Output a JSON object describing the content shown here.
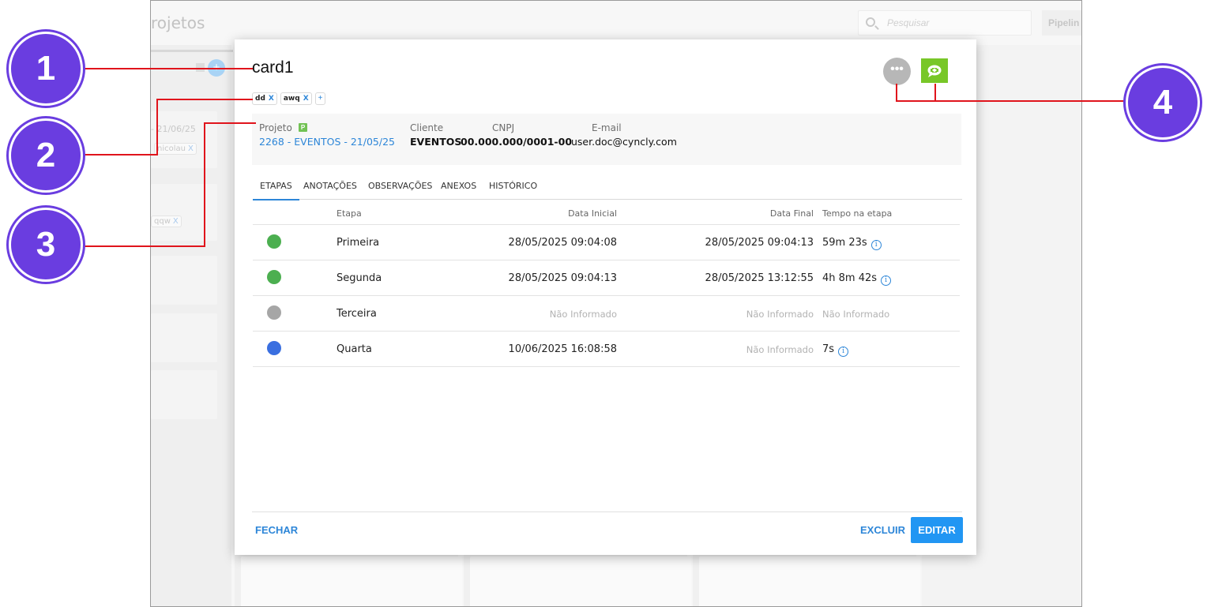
{
  "background_app": {
    "title_partial": "rojetos",
    "search_placeholder": "Pesquisar",
    "pipeline_button_partial": "Pipelin",
    "card_date_partial": "- 21/06/25",
    "tag_nicolau_partial": "nicolau",
    "tag_qqw": "qqw",
    "tag_remove": "X"
  },
  "modal": {
    "title": "card1",
    "tags": [
      {
        "label": "dd",
        "remove": "X"
      },
      {
        "label": "awq",
        "remove": "X"
      }
    ],
    "add_tag_label": "+",
    "more_button_label": "•••",
    "info": {
      "projeto_label": "Projeto",
      "projeto_badge": "P",
      "projeto_value": "2268 - EVENTOS - 21/05/25",
      "cliente_label": "Cliente",
      "cliente_value": "EVENTOS",
      "cnpj_label": "CNPJ",
      "cnpj_value": "00.000.000/0001-00",
      "email_label": "E-mail",
      "email_value": "user.doc@cyncly.com"
    },
    "tabs": [
      "ETAPAS",
      "ANOTAÇÕES",
      "OBSERVAÇÕES",
      "ANEXOS",
      "HISTÓRICO"
    ],
    "active_tab": "ETAPAS",
    "table": {
      "headers": {
        "etapa": "Etapa",
        "data_inicial": "Data Inicial",
        "data_final": "Data Final",
        "tempo": "Tempo na etapa"
      },
      "rows": [
        {
          "status_color": "#4caf50",
          "etapa": "Primeira",
          "data_inicial": "28/05/2025 09:04:08",
          "data_final": "28/05/2025 09:04:13",
          "tempo": "59m 23s",
          "info": "i"
        },
        {
          "status_color": "#4caf50",
          "etapa": "Segunda",
          "data_inicial": "28/05/2025 09:04:13",
          "data_final": "28/05/2025 13:12:55",
          "tempo": "4h 8m 42s",
          "info": "i"
        },
        {
          "status_color": "#a6a6a6",
          "etapa": "Terceira",
          "data_inicial": "Não Informado",
          "data_final": "Não Informado",
          "tempo": "Não Informado"
        },
        {
          "status_color": "#3a6fe0",
          "etapa": "Quarta",
          "data_inicial": "10/06/2025 16:08:58",
          "data_final": "Não Informado",
          "tempo": "7s",
          "info": "i"
        }
      ]
    },
    "footer": {
      "fechar": "FECHAR",
      "excluir": "EXCLUIR",
      "editar": "EDITAR"
    }
  },
  "callouts": [
    "1",
    "2",
    "3",
    "4"
  ],
  "colors": {
    "accent": "#2196f3",
    "link": "#2d86d8",
    "callout": "#6a3de0",
    "callout_line": "#e0141c",
    "chat_button": "#78c728"
  }
}
